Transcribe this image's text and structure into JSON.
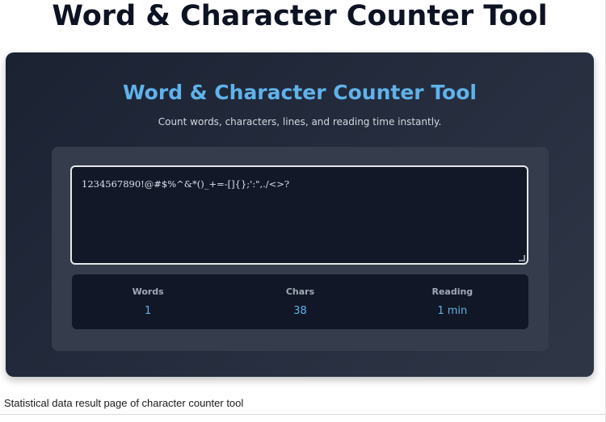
{
  "page": {
    "heading": "Word & Character Counter Tool",
    "caption": "Statistical data result page of character counter tool"
  },
  "app": {
    "title": "Word & Character Counter Tool",
    "subtitle": "Count words, characters, lines, and reading time instantly.",
    "accent_color": "#60b2ea",
    "input": {
      "value": "1234567890!@#$%^&*()_+=-[]{};':\",./<>?"
    },
    "stats": [
      {
        "label": "Words",
        "value": "1"
      },
      {
        "label": "Chars",
        "value": "38"
      },
      {
        "label": "Reading",
        "value": "1 min"
      }
    ]
  },
  "icons": {
    "resize_grip": "resize-grip-icon"
  }
}
